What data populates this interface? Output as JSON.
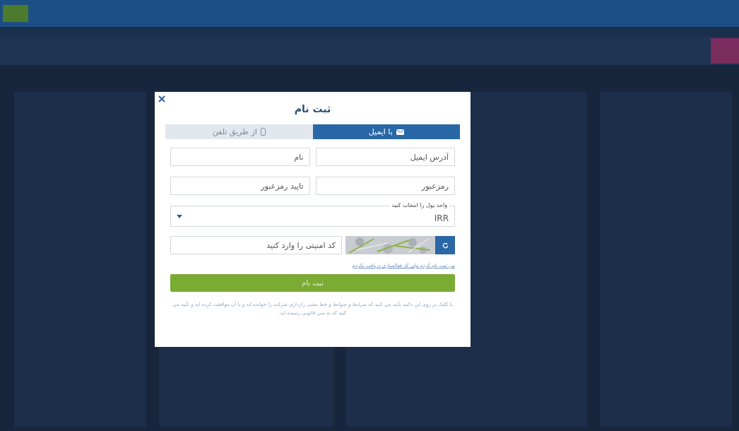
{
  "dialog": {
    "title": "ثبت نام",
    "tabs": [
      {
        "label": "با ایمیل",
        "kind": "email",
        "selected": true
      },
      {
        "label": "از طریق تلفن",
        "kind": "phone",
        "selected": false
      }
    ],
    "fields": [
      {
        "placeholder": "آدرس ایمیل"
      },
      {
        "placeholder": "نام"
      },
      {
        "placeholder": "رمزعبور"
      },
      {
        "placeholder": "تایید رمزعبور"
      }
    ],
    "currency": {
      "label": "واحد پول را انتخاب کنید",
      "value": "IRR"
    },
    "captcha": {
      "placeholder": "کد امنیتی را وارد کنید"
    },
    "activation_link": "من ثبت نام کردم ولی کد فعالسازی دریافت نکردم",
    "submit": "ثبت نام",
    "terms": "با کلیک بر روی این دکمه تأیید می کنید که شرایط و ضوابط و خط مشی رازداری شرکت را خوانده اید و با آن موافقت کرده اید و تأیید می کنید که به سن قانونی رسیده اید."
  }
}
